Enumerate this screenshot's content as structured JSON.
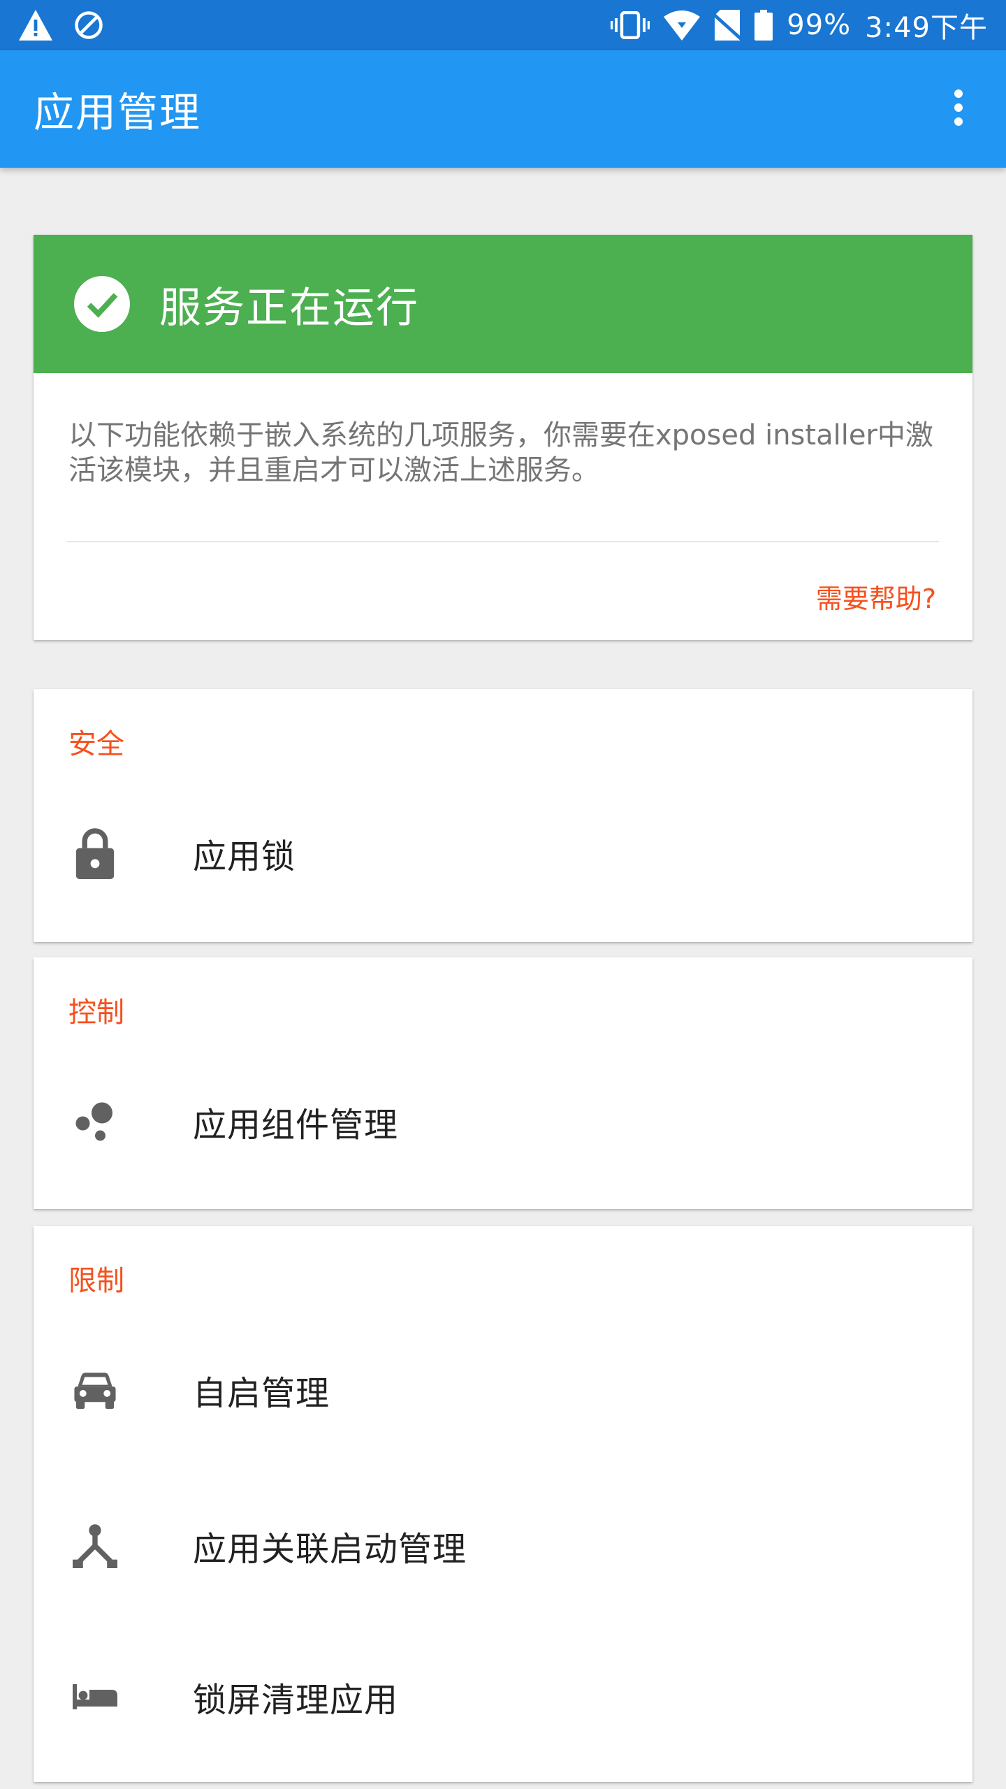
{
  "status_bar": {
    "battery": "99%",
    "time": "3:49下午",
    "left_icons": [
      "warning-icon",
      "blocked-icon"
    ],
    "right_icons": [
      "vibrate-icon",
      "wifi-icon",
      "no-sim-icon",
      "battery-icon"
    ]
  },
  "app_bar": {
    "title": "应用管理",
    "overflow_icon": "more-vert-icon"
  },
  "service_card": {
    "title": "服务正在运行",
    "description": "以下功能依赖于嵌入系统的几项服务，你需要在xposed installer中激活该模块，并且重启才可以激活上述服务。",
    "help_link": "需要帮助?",
    "header_color": "#4CAF50"
  },
  "sections": {
    "security": {
      "title": "安全",
      "items": [
        {
          "label": "应用锁",
          "icon": "lock-icon"
        }
      ]
    },
    "control": {
      "title": "控制",
      "items": [
        {
          "label": "应用组件管理",
          "icon": "bubbles-icon"
        }
      ]
    },
    "restrict": {
      "title": "限制",
      "items": [
        {
          "label": "自启管理",
          "icon": "car-icon"
        },
        {
          "label": "应用关联启动管理",
          "icon": "fork-icon"
        },
        {
          "label": "锁屏清理应用",
          "icon": "bed-icon"
        }
      ]
    }
  },
  "colors": {
    "primary": "#2196F3",
    "primary_dark": "#1976D2",
    "accent": "#F4511E",
    "success": "#4CAF50"
  }
}
